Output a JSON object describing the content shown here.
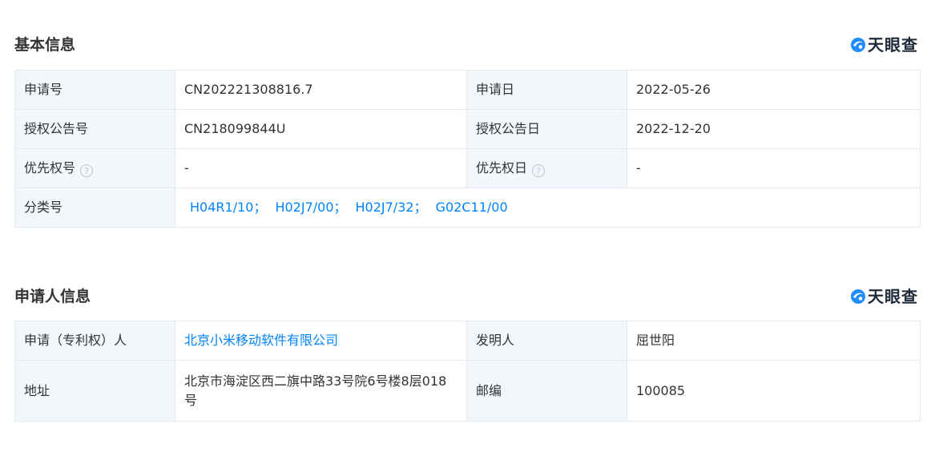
{
  "sections": {
    "basic": {
      "title": "基本信息",
      "brand": "天眼查",
      "rows": {
        "application_no": {
          "label": "申请号",
          "value": "CN202221308816.7"
        },
        "application_date": {
          "label": "申请日",
          "value": "2022-05-26"
        },
        "publication_no": {
          "label": "授权公告号",
          "value": "CN218099844U"
        },
        "publication_date": {
          "label": "授权公告日",
          "value": "2022-12-20"
        },
        "priority_no": {
          "label": "优先权号",
          "value": "-"
        },
        "priority_date": {
          "label": "优先权日",
          "value": "-"
        },
        "classification": {
          "label": "分类号",
          "items": [
            "H04R1/10",
            "H02J7/00",
            "H02J7/32",
            "G02C11/00"
          ],
          "separator": "；"
        }
      }
    },
    "applicant": {
      "title": "申请人信息",
      "brand": "天眼查",
      "rows": {
        "applicant": {
          "label": "申请（专利权）人",
          "value": "北京小米移动软件有限公司"
        },
        "inventor": {
          "label": "发明人",
          "value": "屈世阳"
        },
        "address": {
          "label": "地址",
          "value": "北京市海淀区西二旗中路33号院6号楼8层018号"
        },
        "postcode": {
          "label": "邮编",
          "value": "100085"
        }
      }
    }
  },
  "icons": {
    "help": "?",
    "brand_logo": "tianyancha-logo-icon"
  },
  "colors": {
    "link": "#0084ff",
    "label_bg": "#f2f7fc",
    "border": "#e4eaf1",
    "text": "#333333"
  }
}
